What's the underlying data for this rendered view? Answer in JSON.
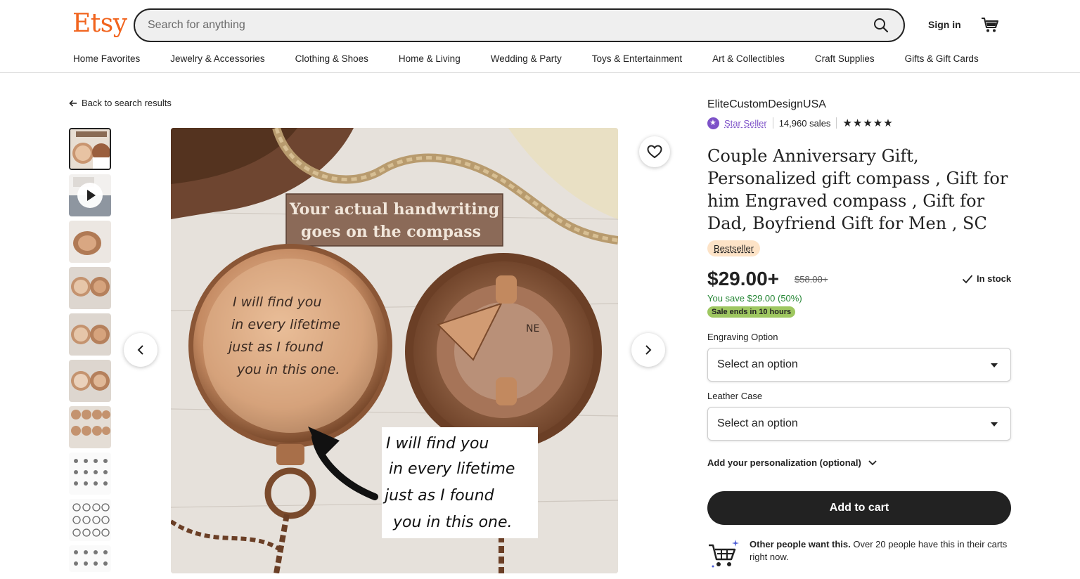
{
  "header": {
    "logo": "Etsy",
    "search_placeholder": "Search for anything",
    "signin": "Sign in"
  },
  "nav": [
    "Home Favorites",
    "Jewelry & Accessories",
    "Clothing & Shoes",
    "Home & Living",
    "Wedding & Party",
    "Toys & Entertainment",
    "Art & Collectibles",
    "Craft Supplies",
    "Gifts & Gift Cards"
  ],
  "back_link": "Back to search results",
  "image": {
    "banner_line1": "Your actual handwriting",
    "banner_line2": "goes on the compass",
    "handwriting": [
      "I will find you",
      "in every lifetime",
      "just as I found",
      "you in this one."
    ]
  },
  "listing": {
    "shop_name": "EliteCustomDesignUSA",
    "star_seller": "Star Seller",
    "sales": "14,960 sales",
    "rating_stars": "★★★★★",
    "title": "Couple Anniversary Gift, Personalized gift compass , Gift for him Engraved compass , Gift for Dad, Boyfriend Gift for Men , SC",
    "badge": "Bestseller",
    "price": "$29.00+",
    "original_price": "$58.00+",
    "in_stock": "In stock",
    "savings": "You save $29.00 (50%)",
    "sale_ends": "Sale ends in 10 hours",
    "option1_label": "Engraving Option",
    "option1_value": "Select an option",
    "option2_label": "Leather Case",
    "option2_value": "Select an option",
    "personalization": "Add your personalization (optional)",
    "add_to_cart": "Add to cart",
    "others_bold": "Other people want this.",
    "others_text": " Over 20 people have this in their carts right now."
  },
  "colors": {
    "brand": "#f1641e",
    "star_seller": "#7d52c8",
    "sale_green": "#9ec760",
    "save_green": "#258635"
  }
}
